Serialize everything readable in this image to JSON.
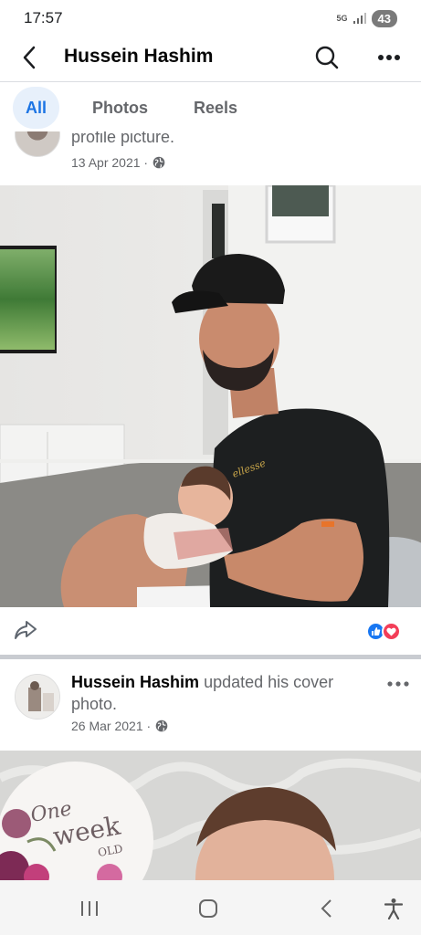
{
  "status_bar": {
    "time": "17:57",
    "network": "5G",
    "battery": "43"
  },
  "header": {
    "title": "Hussein Hashim",
    "icons": [
      "back-arrow-icon",
      "search-icon",
      "more-icon"
    ]
  },
  "tabs": [
    {
      "label": "All",
      "active": true
    },
    {
      "label": "Photos",
      "active": false
    },
    {
      "label": "Reels",
      "active": false
    }
  ],
  "posts": [
    {
      "text": "profile picture.",
      "date": "13 Apr 2021 ·",
      "privacy": "globe-icon",
      "reactions": [
        "like",
        "love"
      ]
    },
    {
      "author": "Hussein Hashim",
      "action": "updated his cover photo.",
      "date": "26 Mar 2021 ·",
      "privacy": "globe-icon",
      "photo_text": {
        "line1": "One",
        "line2": "week",
        "line3": "OLD"
      }
    }
  ],
  "photo1_text": {
    "shirt_brand": "ellesse"
  },
  "nav_bar": {
    "icons": [
      "recent-apps-icon",
      "home-icon",
      "back-icon",
      "accessibility-icon"
    ]
  },
  "colors": {
    "accent": "#1b74e4",
    "like": "#1877f2",
    "love": "#f33e58"
  }
}
